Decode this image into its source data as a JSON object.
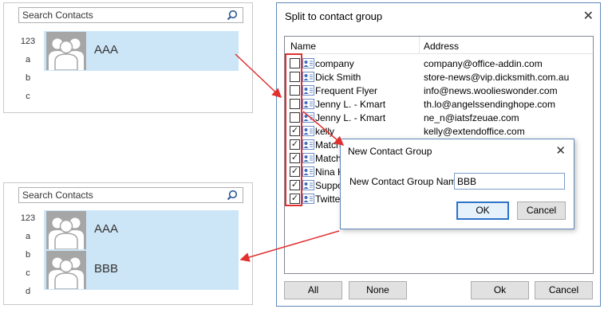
{
  "panel_top": {
    "search_placeholder": "Search Contacts",
    "index": [
      "123",
      "a",
      "b",
      "c"
    ],
    "contacts": [
      {
        "name": "AAA"
      }
    ]
  },
  "panel_bottom": {
    "search_placeholder": "Search Contacts",
    "index": [
      "123",
      "a",
      "b",
      "c",
      "d"
    ],
    "contacts": [
      {
        "name": "AAA"
      },
      {
        "name": "BBB"
      }
    ]
  },
  "split_dialog": {
    "title": "Split to contact group",
    "col_name": "Name",
    "col_address": "Address",
    "rows": [
      {
        "name": "company",
        "address": "company@office-addin.com",
        "checked": false
      },
      {
        "name": "Dick Smith",
        "address": "store-news@vip.dicksmith.com.au",
        "checked": false
      },
      {
        "name": "Frequent Flyer",
        "address": "info@news.woolieswonder.com",
        "checked": false
      },
      {
        "name": "Jenny L. - Kmart",
        "address": "th.lo@angelssendinghope.com",
        "checked": false
      },
      {
        "name": "Jenny L. - Kmart",
        "address": "ne_n@iatsfzeuae.com",
        "checked": false
      },
      {
        "name": "kelly",
        "address": "kelly@extendoffice.com",
        "checked": true
      },
      {
        "name": "Match",
        "address": "",
        "checked": true
      },
      {
        "name": "Match",
        "address": "",
        "checked": true
      },
      {
        "name": "Nina K",
        "address": "",
        "checked": true
      },
      {
        "name": "Support",
        "address": "",
        "checked": true
      },
      {
        "name": "Twitter",
        "address": "",
        "checked": true
      }
    ],
    "btn_all": "All",
    "btn_none": "None",
    "btn_ok": "Ok",
    "btn_cancel": "Cancel"
  },
  "new_group_dialog": {
    "title": "New Contact Group",
    "label": "New Contact Group Name:",
    "value": "BBB",
    "btn_ok": "OK",
    "btn_cancel": "Cancel"
  },
  "colors": {
    "accent": "#e0302f",
    "selection": "#cde6f7",
    "dialog_border": "#5f89b7"
  }
}
